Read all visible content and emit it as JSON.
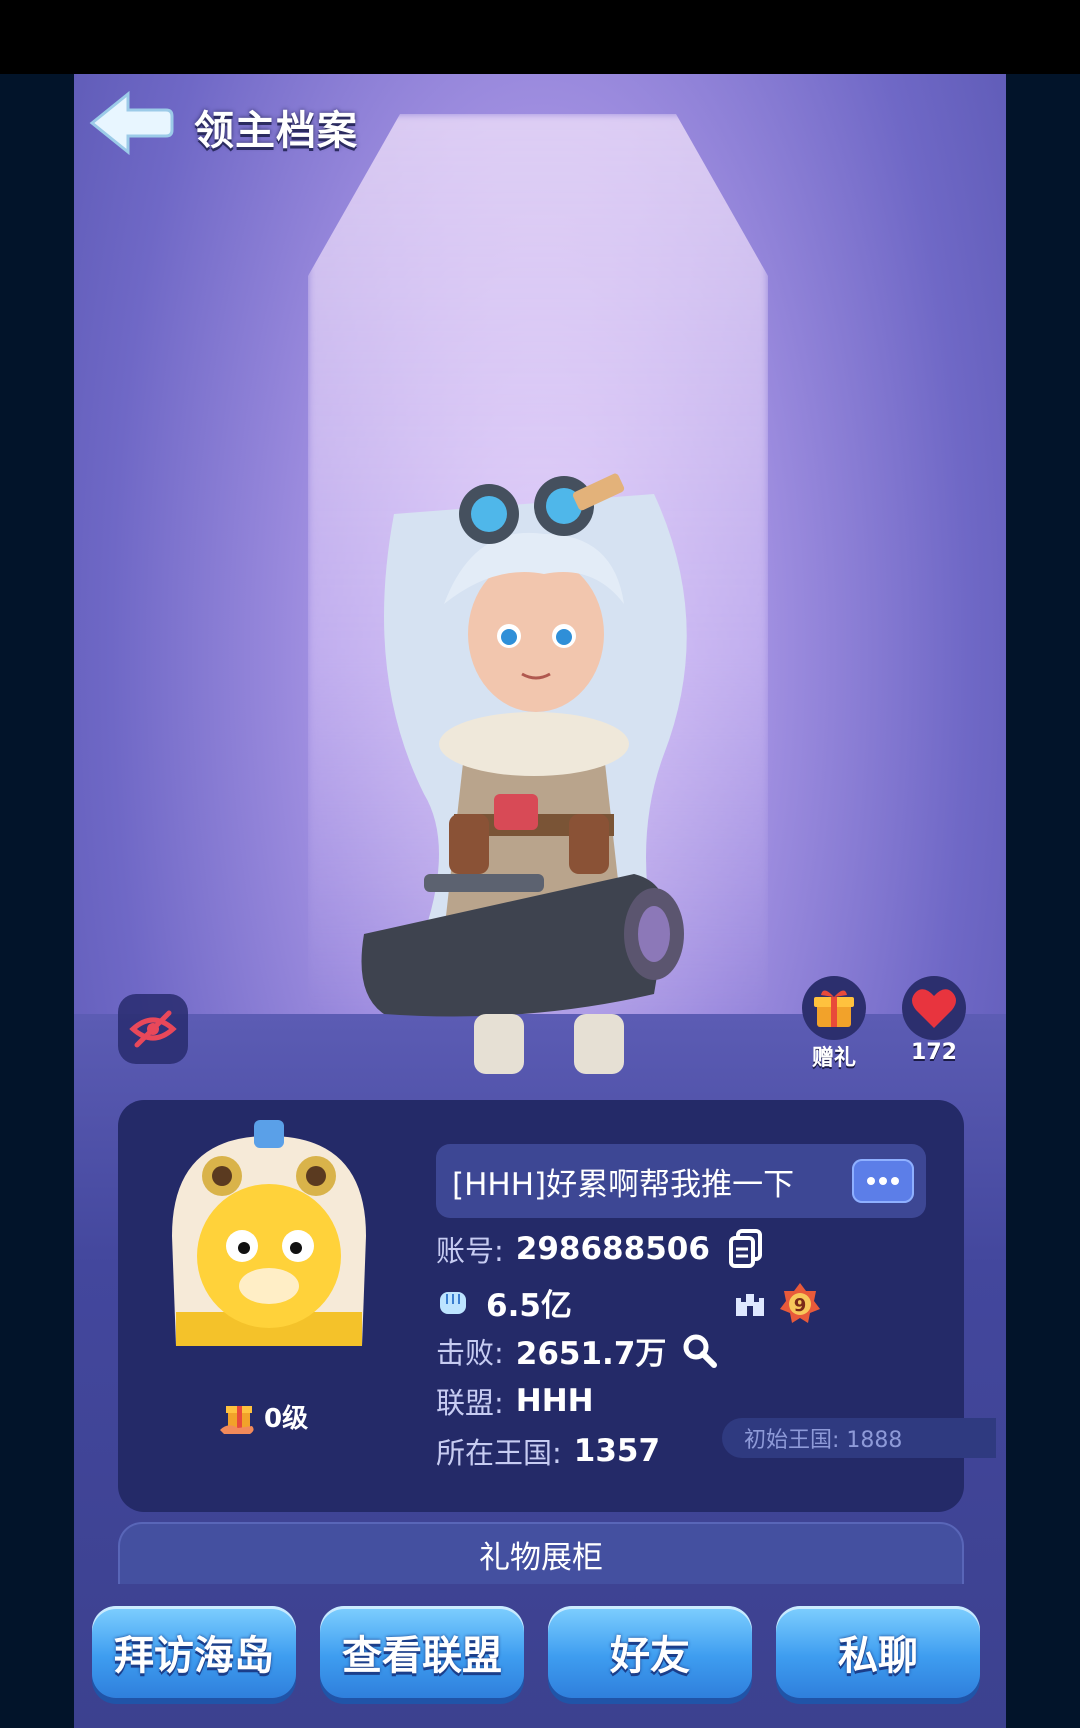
{
  "header": {
    "title": "领主档案"
  },
  "actions": {
    "gift_label": "赠礼",
    "likes_count": "172"
  },
  "profile": {
    "signature": "[HHH]好累啊帮我推一下",
    "account_label": "账号:",
    "account_id": "298688506",
    "power_value": "6.5亿",
    "castle_level": "9",
    "defeat_label": "击败:",
    "defeat_value": "2651.7万",
    "alliance_label": "联盟:",
    "alliance_value": "HHH",
    "kingdom_label": "所在王国:",
    "kingdom_value": "1357",
    "origin_kingdom": "初始王国: 1888",
    "gift_level": "0级"
  },
  "gift_showcase_label": "礼物展柜",
  "bottom_buttons": [
    {
      "label": "拜访海岛"
    },
    {
      "label": "查看联盟"
    },
    {
      "label": "好友"
    },
    {
      "label": "私聊"
    }
  ],
  "colors": {
    "background_accent": "#9f8ee0",
    "card": "#242a68",
    "button_blue": "#3e9df0",
    "heart_red": "#e8343e"
  },
  "icons": [
    "back-arrow-icon",
    "eye-off-icon",
    "gift-icon",
    "heart-icon",
    "copy-icon",
    "fist-icon",
    "castle-icon",
    "level-badge-icon",
    "magnifier-icon",
    "more-icon"
  ]
}
